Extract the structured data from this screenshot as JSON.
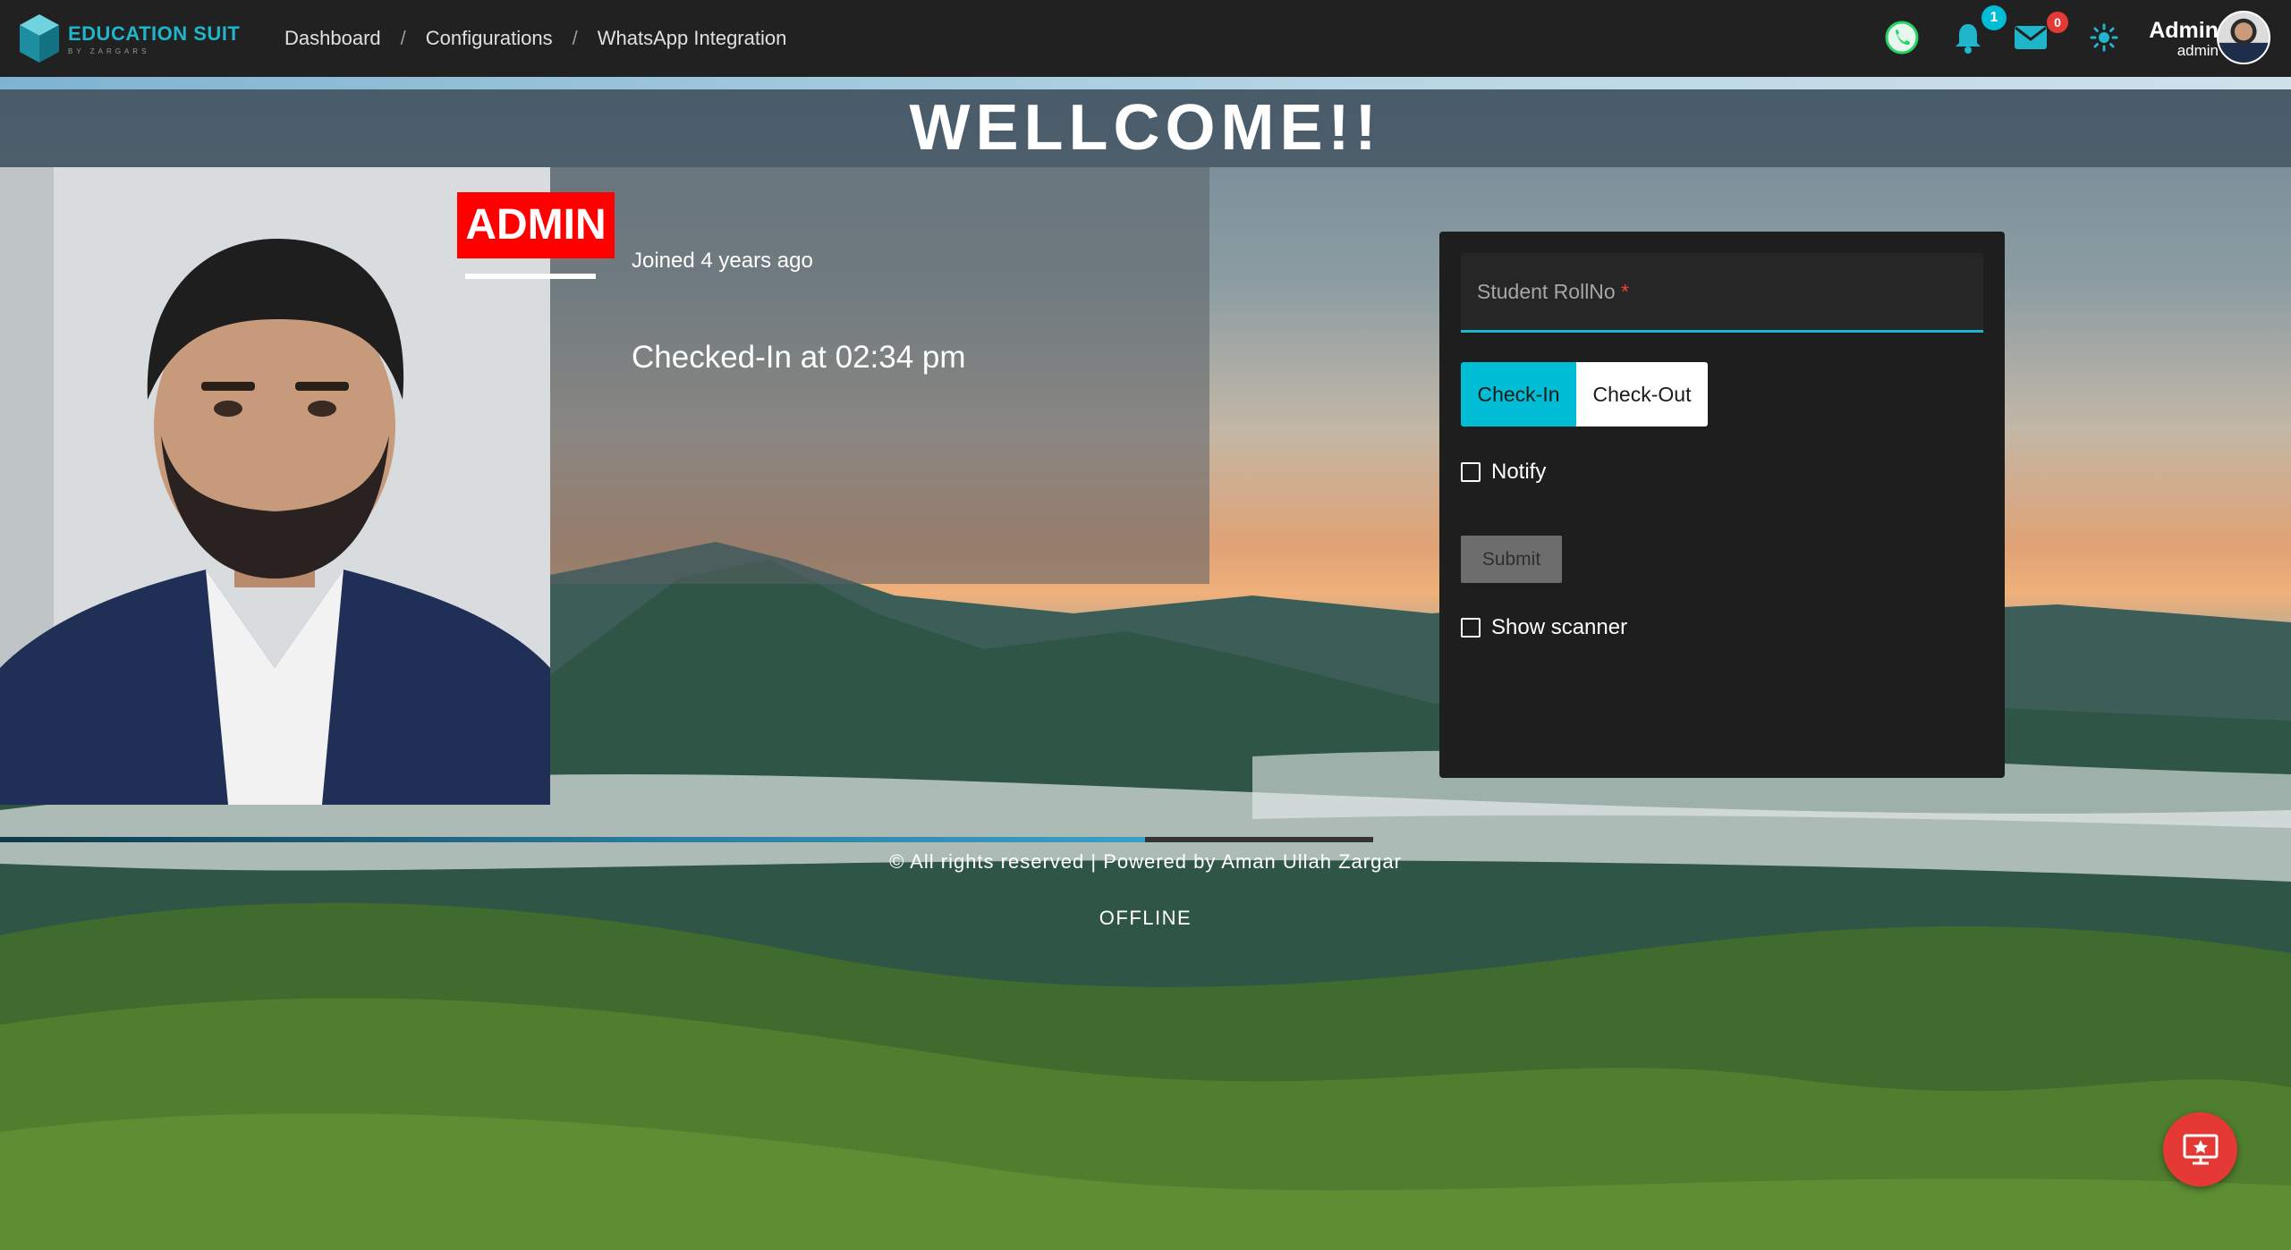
{
  "brand": {
    "name": "EDUCATION SUIT",
    "sub": "BY ZARGARS"
  },
  "breadcrumb": {
    "items": [
      "Dashboard",
      "Configurations",
      "WhatsApp Integration"
    ],
    "separator": "/"
  },
  "header": {
    "icons": [
      "whatsapp-icon",
      "bell-icon",
      "envelope-icon",
      "sun-icon"
    ],
    "notifications_count": "1",
    "messages_count": "0",
    "user_name": "Admin",
    "user_role": "admin"
  },
  "welcome": {
    "text": "WELLCOME!!"
  },
  "profile": {
    "role": "ADMIN",
    "joined": "Joined 4 years ago",
    "status": "Checked-In at 02:34 pm"
  },
  "form": {
    "roll_label": "Student RollNo",
    "required_mark": "*",
    "checkin_label": "Check-In",
    "checkout_label": "Check-Out",
    "notify_label": "Notify",
    "notify_checked": false,
    "submit_label": "Submit",
    "scanner_label": "Show scanner",
    "scanner_checked": false
  },
  "footer": {
    "text": "© All rights reserved | Powered by Aman Ullah Zargar",
    "status": "OFFLINE"
  },
  "colors": {
    "accent": "#1fb6cc",
    "checkin": "#00bcd4",
    "role_badge": "#ff0000",
    "fab": "#e53935"
  }
}
